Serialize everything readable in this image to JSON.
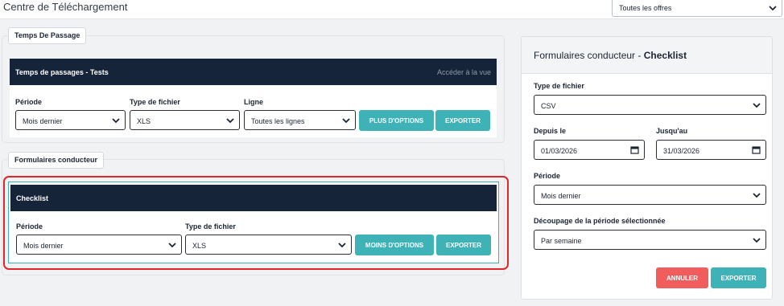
{
  "header": {
    "title": "Centre de Téléchargement",
    "offer_select": "Toutes les offres"
  },
  "section_passage": {
    "tab_label": "Temps De Passage",
    "card": {
      "title": "Temps de passages - Tests",
      "link": "Accéder à la vue",
      "periode_label": "Période",
      "periode_value": "Mois dernier",
      "type_label": "Type de fichier",
      "type_value": "XLS",
      "ligne_label": "Ligne",
      "ligne_value": "Toutes les lignes",
      "more_options": "PLUS D'OPTIONS",
      "export": "EXPORTER"
    }
  },
  "section_formulaires": {
    "tab_label": "Formulaires conducteur",
    "card": {
      "title": "Checklist",
      "periode_label": "Période",
      "periode_value": "Mois dernier",
      "type_label": "Type de fichier",
      "type_value": "XLS",
      "less_options": "MOINS D'OPTIONS",
      "export": "EXPORTER"
    }
  },
  "side_panel": {
    "title_prefix": "Formulaires conducteur - ",
    "title_bold": "Checklist",
    "type_label": "Type de fichier",
    "type_value": "CSV",
    "from_label": "Depuis le",
    "from_value": "01/03/2026",
    "to_label": "Jusqu'au",
    "to_value": "31/03/2026",
    "periode_label": "Période",
    "periode_value": "Mois dernier",
    "split_label": "Découpage de la période sélectionnée",
    "split_value": "Par semaine",
    "cancel": "ANNULER",
    "export": "EXPORTER"
  },
  "colors": {
    "header_navy": "#152439",
    "teal": "#3fb2b8",
    "red": "#f05d5c",
    "highlight": "#e0262a"
  }
}
